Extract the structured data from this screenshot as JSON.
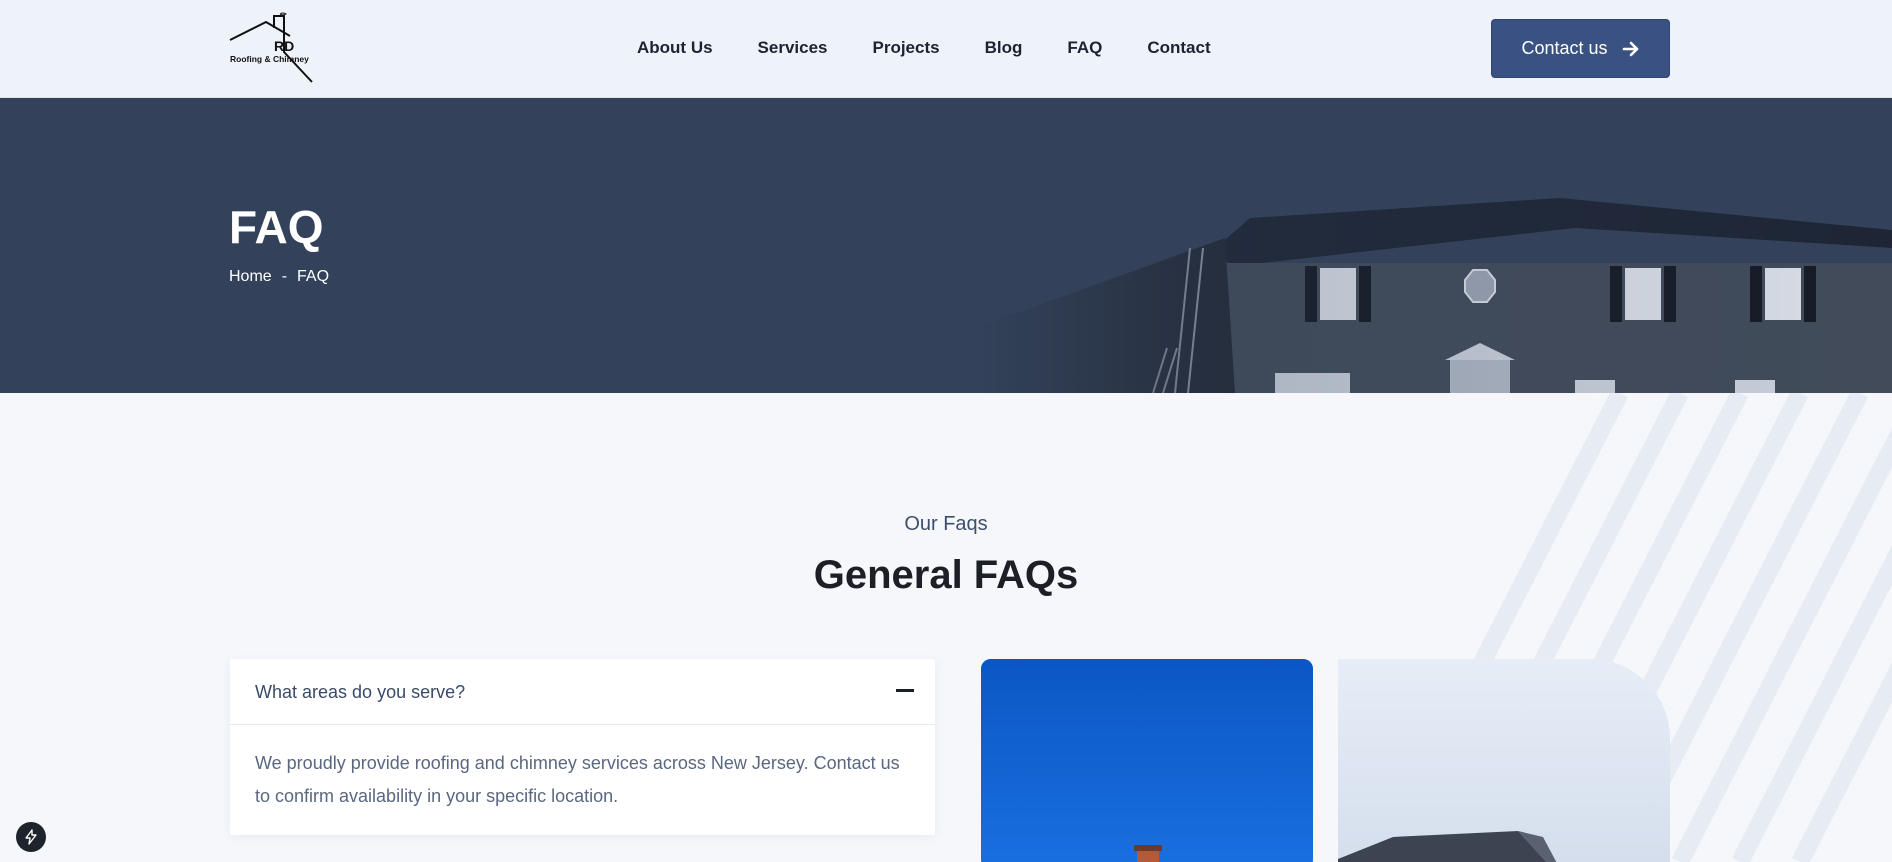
{
  "header": {
    "logo": {
      "name": "RD",
      "subtitle": "Roofing & Chimney"
    },
    "nav": [
      "About Us",
      "Services",
      "Projects",
      "Blog",
      "FAQ",
      "Contact"
    ],
    "cta_label": "Contact us"
  },
  "hero": {
    "title": "FAQ",
    "breadcrumb": {
      "home": "Home",
      "separator": "-",
      "current": "FAQ"
    }
  },
  "faq_section": {
    "eyebrow": "Our Faqs",
    "title": "General FAQs",
    "items": [
      {
        "question": "What areas do you serve?",
        "answer": "We proudly provide roofing and chimney services across New Jersey. Contact us to confirm availability in your specific location.",
        "expanded": true
      }
    ]
  },
  "colors": {
    "primary": "#3a5283",
    "hero_overlay": "#33425a",
    "text_dark": "#1c1f26",
    "text_muted": "#5a6780"
  },
  "icons": [
    "arrow-right-icon",
    "minus-icon",
    "lightning-icon"
  ]
}
